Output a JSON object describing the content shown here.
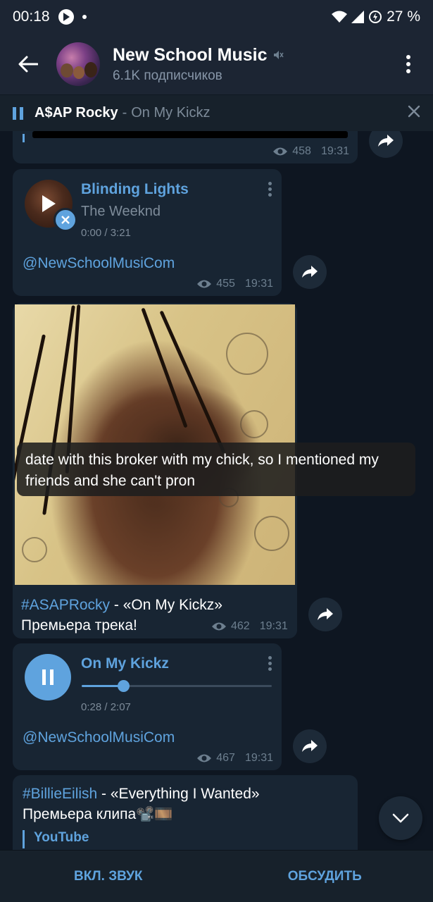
{
  "status_bar": {
    "time": "00:18",
    "battery": "27 %"
  },
  "header": {
    "channel_name": "New School Music",
    "subscribers": "6.1K подписчиков"
  },
  "player": {
    "artist": "A$AP Rocky",
    "separator": "-",
    "track": "On My Kickz"
  },
  "messages": {
    "top_partial": {
      "views": "458",
      "time": "19:31"
    },
    "blinding": {
      "title": "Blinding Lights",
      "artist": "The Weeknd",
      "duration": "0:00 / 3:21",
      "link": "@NewSchoolMusiCom",
      "views": "455",
      "time": "19:31"
    },
    "photo_post": {
      "overlay": "date with this broker with my chick, so I mentioned my friends and she can't pron",
      "hashtag": "#ASAPRocky",
      "text": " - «On My Kickz»",
      "text2": "Премьера трека!",
      "views": "462",
      "time": "19:31"
    },
    "kickz": {
      "title": "On My Kickz",
      "duration": "0:28 / 2:07",
      "progress": 0.22,
      "link": "@NewSchoolMusiCom",
      "views": "467",
      "time": "19:31"
    },
    "billie": {
      "hashtag": "#BillieEilish",
      "text": " - «Everything I Wanted»",
      "text2": "Премьера клипа📽️🎞️",
      "source": "YouTube"
    }
  },
  "bottom": {
    "unmute": "ВКЛ. ЗВУК",
    "discuss": "ОБСУДИТЬ"
  },
  "colors": {
    "accent": "#5fa3de",
    "bubble": "#182533",
    "background": "#0e1621"
  }
}
